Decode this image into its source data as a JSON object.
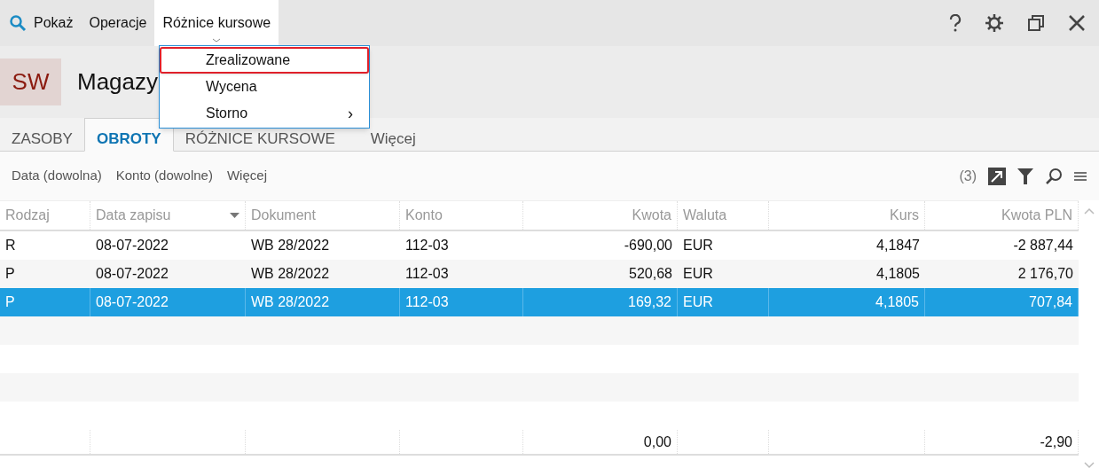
{
  "menu_bar": [
    {
      "label": "Pokaż",
      "open": false
    },
    {
      "label": "Operacje",
      "open": false
    },
    {
      "label": "Różnice kursowe",
      "open": true
    }
  ],
  "dropdown": [
    {
      "label": "Zrealizowane",
      "highlighted": true
    },
    {
      "label": "Wycena",
      "highlighted": false
    },
    {
      "label": "Storno",
      "highlighted": false,
      "arrow": "›"
    }
  ],
  "header": {
    "badge": "SW",
    "title": "Magazy"
  },
  "tabs": [
    {
      "label": "ZASOBY",
      "selected": false
    },
    {
      "label": "OBROTY",
      "selected": true
    },
    {
      "label": "RÓŻNICE KURSOWE",
      "selected": false
    },
    {
      "label": "Więcej",
      "selected": false
    }
  ],
  "filters": [
    "Data (dowolna)",
    "Konto (dowolne)",
    "Więcej"
  ],
  "filter_count": "(3)",
  "table": {
    "columns": [
      {
        "label": "Rodzaj",
        "kind": "text",
        "sorted": false
      },
      {
        "label": "Data zapisu",
        "kind": "text",
        "sorted": true
      },
      {
        "label": "Dokument",
        "kind": "text",
        "sorted": false
      },
      {
        "label": "Konto",
        "kind": "text",
        "sorted": false
      },
      {
        "label": "Kwota",
        "kind": "number",
        "sorted": false,
        "total": "0,00"
      },
      {
        "label": "Waluta",
        "kind": "text",
        "sorted": false
      },
      {
        "label": "Kurs",
        "kind": "number",
        "sorted": false
      },
      {
        "label": "Kwota PLN",
        "kind": "number",
        "sorted": false,
        "total": "-2,90"
      }
    ],
    "rows": [
      {
        "cells": [
          "R",
          "08-07-2022",
          "WB 28/2022",
          "112-03",
          "-690,00",
          "EUR",
          "4,1847",
          "-2 887,44"
        ],
        "selected": false
      },
      {
        "cells": [
          "P",
          "08-07-2022",
          "WB 28/2022",
          "112-03",
          "520,68",
          "EUR",
          "4,1805",
          "2 176,70"
        ],
        "selected": false
      },
      {
        "cells": [
          "P",
          "08-07-2022",
          "WB 28/2022",
          "112-03",
          "169,32",
          "EUR",
          "4,1805",
          "707,84"
        ],
        "selected": true
      }
    ]
  }
}
